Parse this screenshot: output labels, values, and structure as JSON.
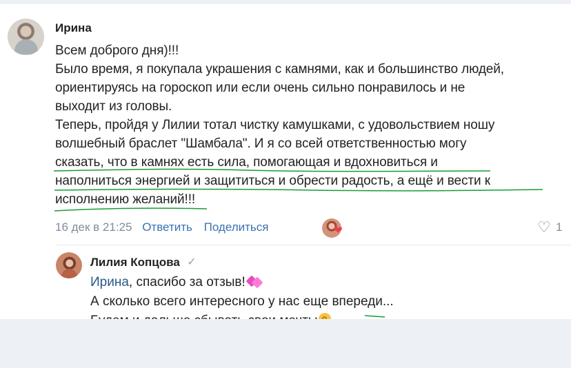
{
  "comment": {
    "author": "Ирина",
    "lines": [
      "Всем доброго дня)!!!",
      "Было время, я покупала украшения с камнями, как и большинство людей,",
      "ориентируясь на гороскоп или если очень сильно понравилось и не",
      "выходит из головы.",
      "Теперь, пройдя у Лилии тотал чистку камушками, с удовольствием ношу",
      "волшебный браслет \"Шамбала\". И я со всей ответственностью могу",
      "сказать, что в камнях есть сила, помогающая и вдохновиться и",
      "наполниться энергией и защититься и обрести радость, а ещё и вести к",
      "исполнению желаний!!!"
    ],
    "date": "16 дек в 21:25",
    "reply_action": "Ответить",
    "share_action": "Поделиться",
    "like_count": "1"
  },
  "reply": {
    "author": "Лилия Копцова",
    "mention": "Ирина",
    "line1_text": ", спасибо за отзыв!",
    "line2": "А сколько всего интересного у нас еще впереди...",
    "line3": "Будем и дальше сбывать свои мечты"
  },
  "icons": {
    "verified": "check-icon",
    "reaction_avatar": "avatar-icon",
    "reaction": "heart-icon",
    "like": "heart-outline-icon",
    "gift": "gift-icon",
    "ok_hand": "ok-hand-icon"
  },
  "colors": {
    "background": "#edf0f5",
    "card": "#ffffff",
    "text": "#222222",
    "muted": "#818c99",
    "link": "#3b72b2",
    "underline": "#179c35",
    "reaction": "#ef3b57"
  }
}
